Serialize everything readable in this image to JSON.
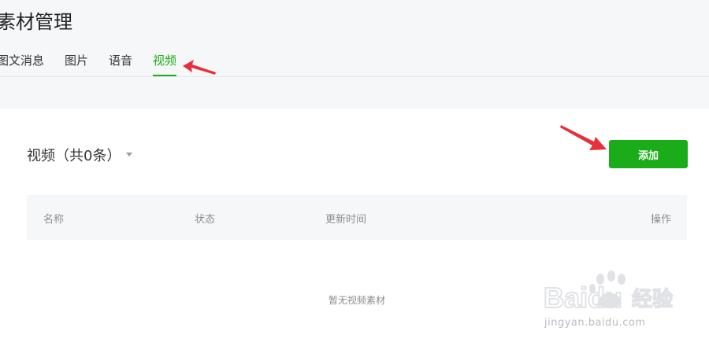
{
  "page": {
    "title": "素材管理"
  },
  "tabs": [
    {
      "label": "图文消息",
      "active": false
    },
    {
      "label": "图片",
      "active": false
    },
    {
      "label": "语音",
      "active": false
    },
    {
      "label": "视频",
      "active": true
    }
  ],
  "section": {
    "title": "视频（共0条）",
    "add_label": "添加"
  },
  "table": {
    "columns": [
      "名称",
      "状态",
      "更新时间",
      "操作"
    ],
    "empty_text": "暂无视频素材"
  },
  "watermark": {
    "brand": "Baidu",
    "suffix": "经验",
    "url": "jingyan.baidu.com"
  },
  "colors": {
    "accent": "#1aad19",
    "annotation_arrow": "#e8303a"
  }
}
